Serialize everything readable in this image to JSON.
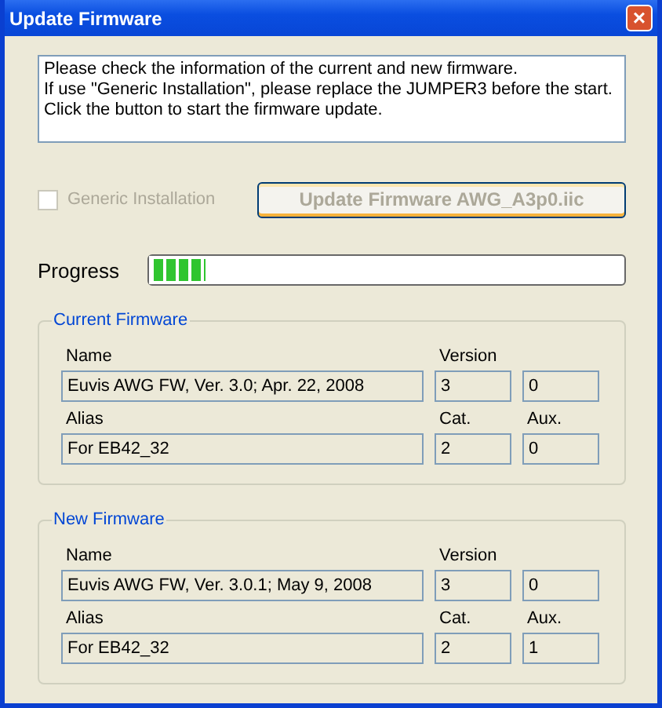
{
  "window": {
    "title": "Update Firmware",
    "close": "×"
  },
  "message": [
    "Please check the information of the current and new firmware.",
    "If use \"Generic Installation\", please replace the JUMPER3 before the start.",
    "Click the button to start the firmware update."
  ],
  "generic_installation": {
    "label": "Generic Installation",
    "checked": false,
    "disabled": true
  },
  "update_button": {
    "label": "Update Firmware AWG_A3p0.iic",
    "disabled": true
  },
  "progress": {
    "label": "Progress",
    "level": 0.12
  },
  "groups": [
    {
      "title": "Current Firmware",
      "name_label": "Name",
      "name": "Euvis AWG FW, Ver. 3.0; Apr. 22, 2008",
      "version_label": "Version",
      "version_major": "3",
      "version_minor": "0",
      "alias_label": "Alias",
      "alias": "For EB42_32",
      "cat_label": "Cat.",
      "cat": "2",
      "aux_label": "Aux.",
      "aux": "0"
    },
    {
      "title": "New Firmware",
      "name_label": "Name",
      "name": "Euvis AWG FW, Ver. 3.0.1; May 9, 2008",
      "version_label": "Version",
      "version_major": "3",
      "version_minor": "0",
      "alias_label": "Alias",
      "alias": "For EB42_32",
      "cat_label": "Cat.",
      "cat": "2",
      "aux_label": "Aux.",
      "aux": "1"
    }
  ]
}
